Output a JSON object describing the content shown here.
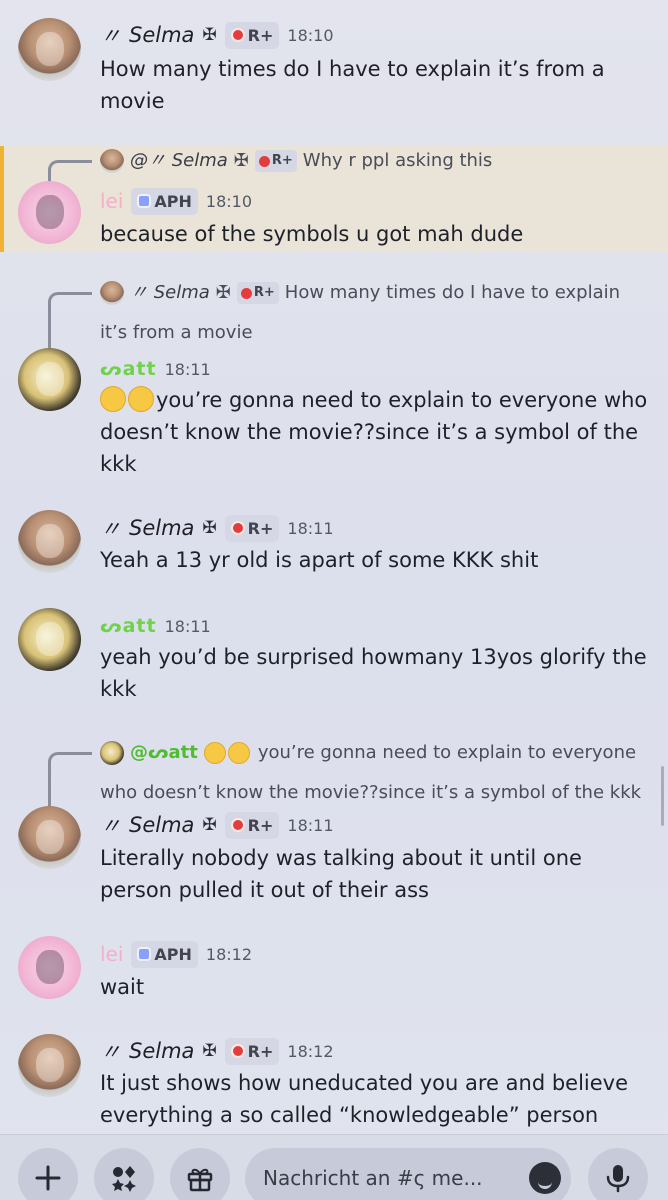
{
  "messages": [
    {
      "author": "Selma",
      "prefix": "〃",
      "symbol": "✠",
      "badge": "R+",
      "time": "18:10",
      "lines": [
        "How many times do I have to explain it’s  from a",
        "movie"
      ]
    },
    {
      "author": "lei",
      "badge": "APH",
      "time": "18:10",
      "highlighted": true,
      "reply": {
        "author": "@〃 Selma",
        "symbol": "✠",
        "badge": "R+",
        "text": "Why r ppl asking this"
      },
      "lines": [
        "because of the symbols u got mah dude"
      ]
    },
    {
      "author": "ᔕatt",
      "time": "18:11",
      "reply": {
        "author": "〃 Selma",
        "symbol": "✠",
        "badge": "R+",
        "text_lines": [
          "How many times do I have to explain",
          "it’s  from a movie"
        ]
      },
      "lines": [
        "you’re gonna need to explain to everyone who",
        "doesn’t know the movie??since it’s a symbol of the",
        "kkk"
      ]
    },
    {
      "author": "Selma",
      "prefix": "〃",
      "symbol": "✠",
      "badge": "R+",
      "time": "18:11",
      "lines": [
        "Yeah a 13 yr old is apart of some KKK shit"
      ]
    },
    {
      "author": "ᔕatt",
      "time": "18:11",
      "lines": [
        "yeah you’d be surprised howmany 13yos glorify the",
        "kkk"
      ]
    },
    {
      "author": "Selma",
      "prefix": "〃",
      "symbol": "✠",
      "badge": "R+",
      "time": "18:11",
      "reply": {
        "author": "@ᔕatt",
        "text_lines": [
          "you’re gonna need to explain to everyone",
          "who doesn’t know the movie??since it’s a symbol of the kkk"
        ]
      },
      "lines": [
        "Literally nobody was talking about it until one",
        "person pulled it out of their ass"
      ]
    },
    {
      "author": "lei",
      "badge": "APH",
      "time": "18:12",
      "lines": [
        "wait"
      ]
    },
    {
      "author": "Selma",
      "prefix": "〃",
      "symbol": "✠",
      "badge": "R+",
      "time": "18:12",
      "lines": [
        "It just shows how uneducated you are and believe",
        "everything a so called “knowledgeable” person says"
      ]
    }
  ],
  "composer": {
    "placeholder": "Nachricht an #ς me..."
  },
  "icons": {
    "add": "plus-icon",
    "apps": "apps-icon",
    "gift": "gift-icon",
    "emoji": "smiley-icon",
    "voice": "microphone-icon"
  }
}
